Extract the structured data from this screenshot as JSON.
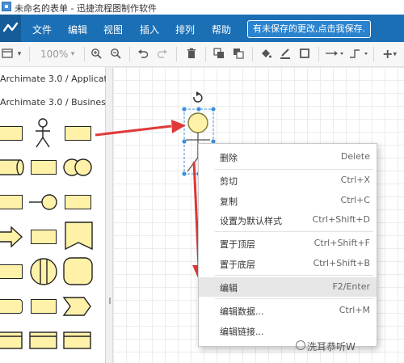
{
  "window": {
    "title": "未命名的表单 - 迅捷流程图制作软件"
  },
  "menubar": {
    "items": [
      "文件",
      "编辑",
      "视图",
      "插入",
      "排列",
      "帮助"
    ],
    "unsaved_notice": "有未保存的更改,点击我保存."
  },
  "toolbar": {
    "zoom": "100%",
    "icons": [
      "format-panel-icon",
      "zoom-in-icon",
      "zoom-out-icon",
      "undo-icon",
      "redo-icon",
      "delete-icon",
      "to-front-icon",
      "to-back-icon",
      "fill-color-icon",
      "line-color-icon",
      "shadow-icon",
      "connection-icon",
      "waypoint-icon",
      "add-icon"
    ]
  },
  "sidebar": {
    "sections": [
      "Archimate 3.0 / Applicat...",
      "Archimate 3.0 / Business"
    ]
  },
  "context_menu": {
    "items": [
      {
        "label": "删除",
        "shortcut": "Delete"
      },
      {
        "label": "剪切",
        "shortcut": "Ctrl+X"
      },
      {
        "label": "复制",
        "shortcut": "Ctrl+C"
      },
      {
        "label": "设置为默认样式",
        "shortcut": "Ctrl+Shift+D"
      },
      {
        "label": "置于顶层",
        "shortcut": "Ctrl+Shift+F"
      },
      {
        "label": "置于底层",
        "shortcut": "Ctrl+Shift+B"
      },
      {
        "label": "编辑",
        "shortcut": "F2/Enter"
      },
      {
        "label": "编辑数据...",
        "shortcut": "Ctrl+M"
      },
      {
        "label": "编辑链接...",
        "shortcut": ""
      }
    ]
  },
  "watermark": {
    "text": "洗耳恭听W"
  },
  "colors": {
    "menubar": "#1b6fb5",
    "shape_fill": "#fff2a8",
    "arrow": "#e03a3a",
    "selection": "#3d8fe0"
  }
}
